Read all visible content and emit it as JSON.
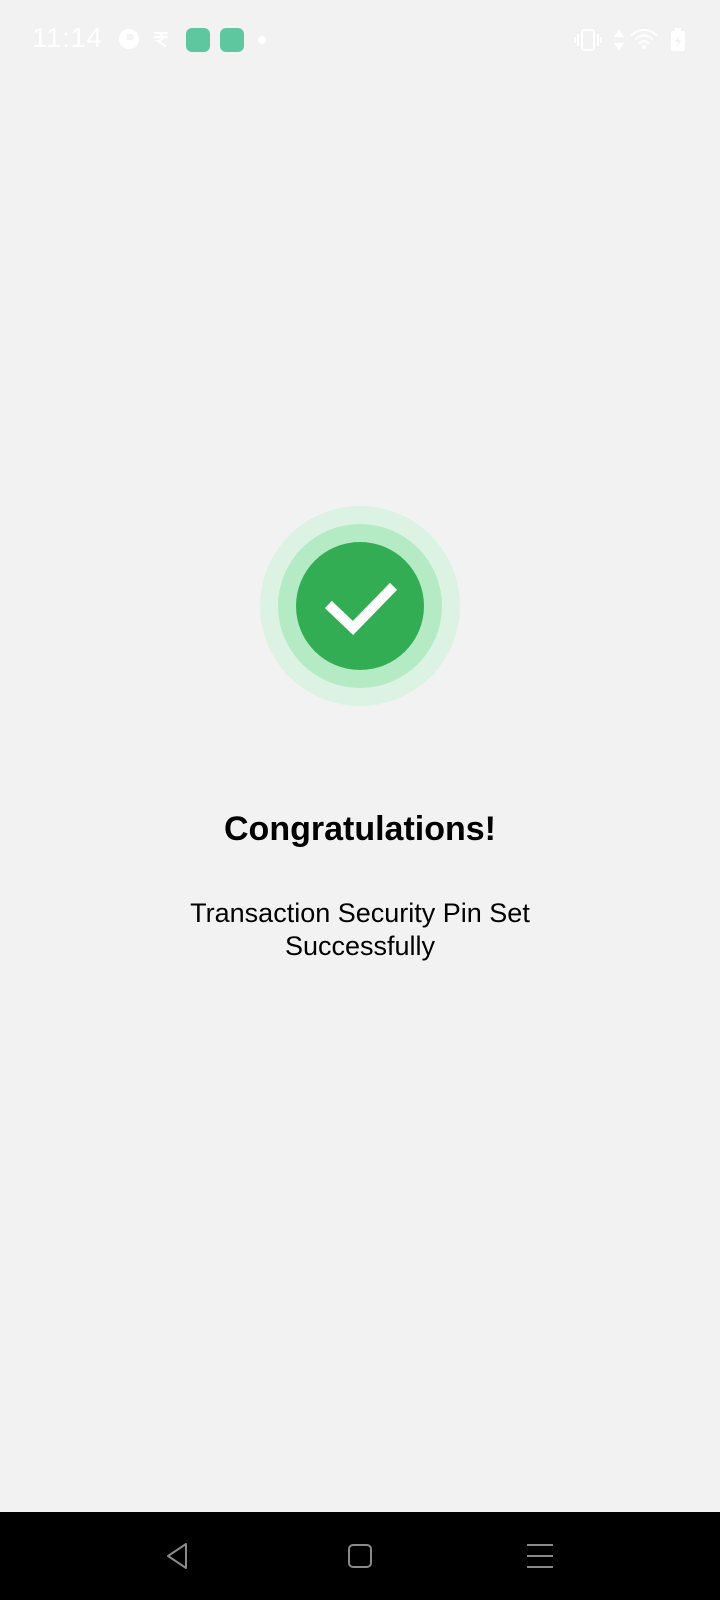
{
  "status_bar": {
    "time": "11:14",
    "icons": [
      "app-logo-icon",
      "rupee-app-icon",
      "app-badge-icon",
      "app-badge-icon",
      "notification-dot-icon",
      "vibrate-icon",
      "data-arrows-icon",
      "wifi-icon",
      "battery-icon"
    ]
  },
  "success": {
    "title": "Congratulations!",
    "message": "Transaction Security Pin Set Successfully",
    "colors": {
      "outer_ring": "#dcf3e4",
      "middle_ring": "#b4eac4",
      "inner_circle": "#33ad54",
      "check": "#ffffff"
    }
  },
  "nav_bar": {
    "buttons": [
      "back-icon",
      "home-icon",
      "menu-icon"
    ]
  }
}
